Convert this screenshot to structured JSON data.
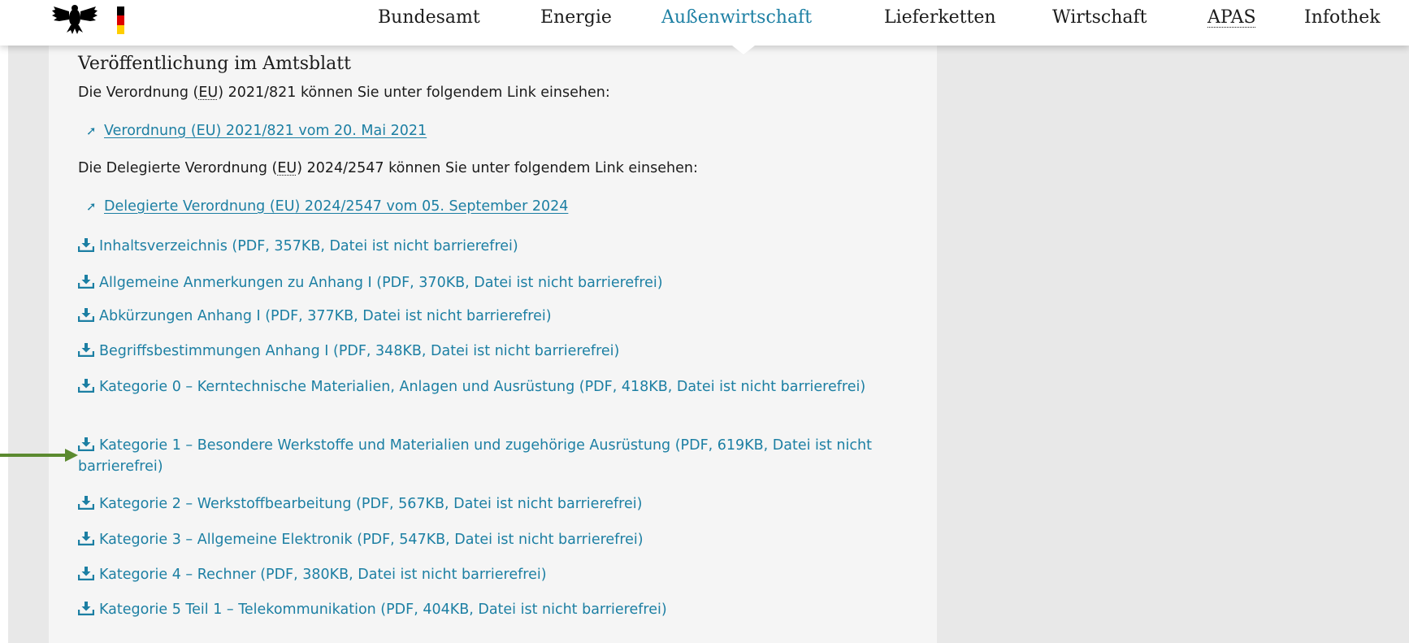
{
  "header": {
    "logo_alt": "Bundesadler",
    "nav": [
      {
        "label": "Bundesamt"
      },
      {
        "label": "Energie"
      },
      {
        "label": "Außenwirtschaft",
        "active": true
      },
      {
        "label": "Lieferketten"
      },
      {
        "label": "Wirtschaft"
      },
      {
        "label": "APAS"
      },
      {
        "label": "Infothek"
      }
    ]
  },
  "colors": {
    "link": "#1c7fa3",
    "text": "#1b1b1b",
    "panel_bg": "#f5f5f5",
    "page_bg": "#e8e8e8",
    "marker_arrow": "#5b8a2f",
    "flag": [
      "#000000",
      "#dd0000",
      "#ffce00"
    ]
  },
  "main": {
    "title": "Veröffentlichung im Amtsblatt",
    "intro1": {
      "pre": "Die Verordnung (",
      "abbr": "EU",
      "post": ") 2021/821 können Sie unter folgendem Link einsehen:"
    },
    "link1": {
      "icon": "external-link-icon",
      "pre": "Verordnung (",
      "abbr": "EU",
      "post": ") 2021/821 vom 20. Mai 2021"
    },
    "intro2": {
      "pre": "Die Delegierte Verordnung (",
      "abbr": "EU",
      "post": ") 2024/2547 können Sie unter folgendem Link einsehen:"
    },
    "link2": {
      "icon": "external-link-icon",
      "pre": "Delegierte Verordnung (",
      "abbr": "EU",
      "post": ") 2024/2547 vom 05. September 2024"
    },
    "downloads": [
      {
        "label": "Inhaltsverzeichnis (PDF, 357KB, Datei ist nicht barrierefrei)"
      },
      {
        "label": "Allgemeine Anmerkungen zu Anhang I (PDF, 370KB, Datei ist nicht barrierefrei)"
      },
      {
        "label": "Abkürzungen Anhang I (PDF, 377KB, Datei ist nicht barrierefrei)"
      },
      {
        "label": "Begriffsbestimmungen Anhang I (PDF, 348KB, Datei ist nicht barrierefrei)"
      },
      {
        "label": "Kategorie 0 – Kerntechnische Materialien, Anlagen und Ausrüstung (PDF, 418KB, Datei ist nicht barrierefrei)"
      },
      {
        "label": "Kategorie 1 – Besondere Werkstoffe und Materialien und zugehörige Ausrüstung (PDF, 619KB, Datei ist nicht barrierefrei)",
        "highlighted": true
      },
      {
        "label": "Kategorie 2 – Werkstoffbearbeitung (PDF, 567KB, Datei ist nicht barrierefrei)"
      },
      {
        "label": "Kategorie 3 – Allgemeine Elektronik (PDF, 547KB, Datei ist nicht barrierefrei)"
      },
      {
        "label": "Kategorie 4 – Rechner (PDF, 380KB, Datei ist nicht barrierefrei)"
      },
      {
        "label": "Kategorie 5 Teil 1 – Telekommunikation (PDF, 404KB, Datei ist nicht barrierefrei)"
      }
    ],
    "download_icon": "download-icon"
  }
}
